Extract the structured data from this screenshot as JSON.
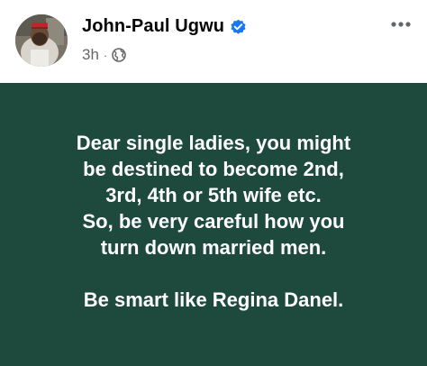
{
  "post": {
    "author": "John-Paul Ugwu",
    "verified": true,
    "time": "3h",
    "separator": "·",
    "audience_icon": "globe-icon",
    "more_icon": "more-options-icon",
    "background_color": "#1d4a3d",
    "text_color": "#ffffff",
    "lines": [
      "Dear single ladies, you might",
      "be destined to become 2nd,",
      "3rd, 4th or 5th wife etc.",
      "So, be very careful how you",
      "turn down married men."
    ],
    "closing_line": "Be smart like Regina Danel."
  },
  "colors": {
    "verified_badge": "#1877f2",
    "meta_text": "#65676b",
    "name_text": "#050505"
  }
}
